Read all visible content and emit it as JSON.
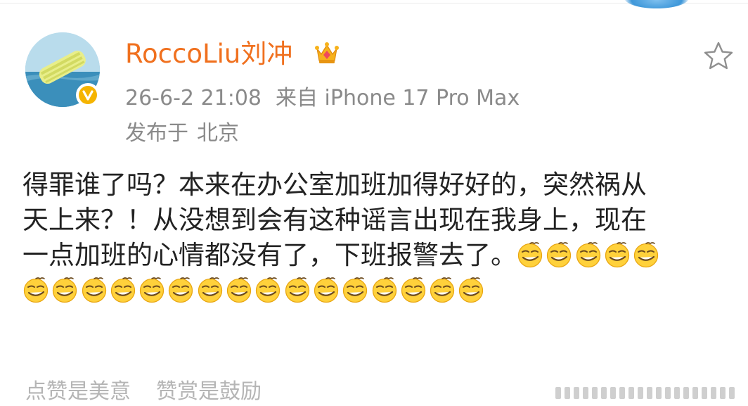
{
  "post": {
    "author": "RoccoLiu刘冲",
    "timestamp": "26-6-2 21:08",
    "source": "来自 iPhone 17 Pro Max",
    "location_label": "发布于",
    "location": "北京",
    "text_lines": [
      "得罪谁了吗？本来在办公室加班加得好好的，突然祸从",
      "天上来？！从没想到会有这种谣言出现在我身上，现在",
      "一点加班的心情都没有了，下班报警去了。"
    ],
    "emoji_name": "smirk-emoji",
    "emoji_count_line3": 5,
    "emoji_count_line4": 16
  },
  "footer": {
    "like_text": "点赞是美意",
    "reward_text": "赞赏是鼓励"
  },
  "icons": {
    "crown": "crown-icon",
    "favorite": "star-outline-icon",
    "verified": "verified-v-icon"
  },
  "colors": {
    "username": "#f0701e",
    "meta": "#8a8a8a",
    "body_text": "#222222",
    "verified_badge": "#f5b400",
    "footer_text": "#b5b5b5"
  }
}
